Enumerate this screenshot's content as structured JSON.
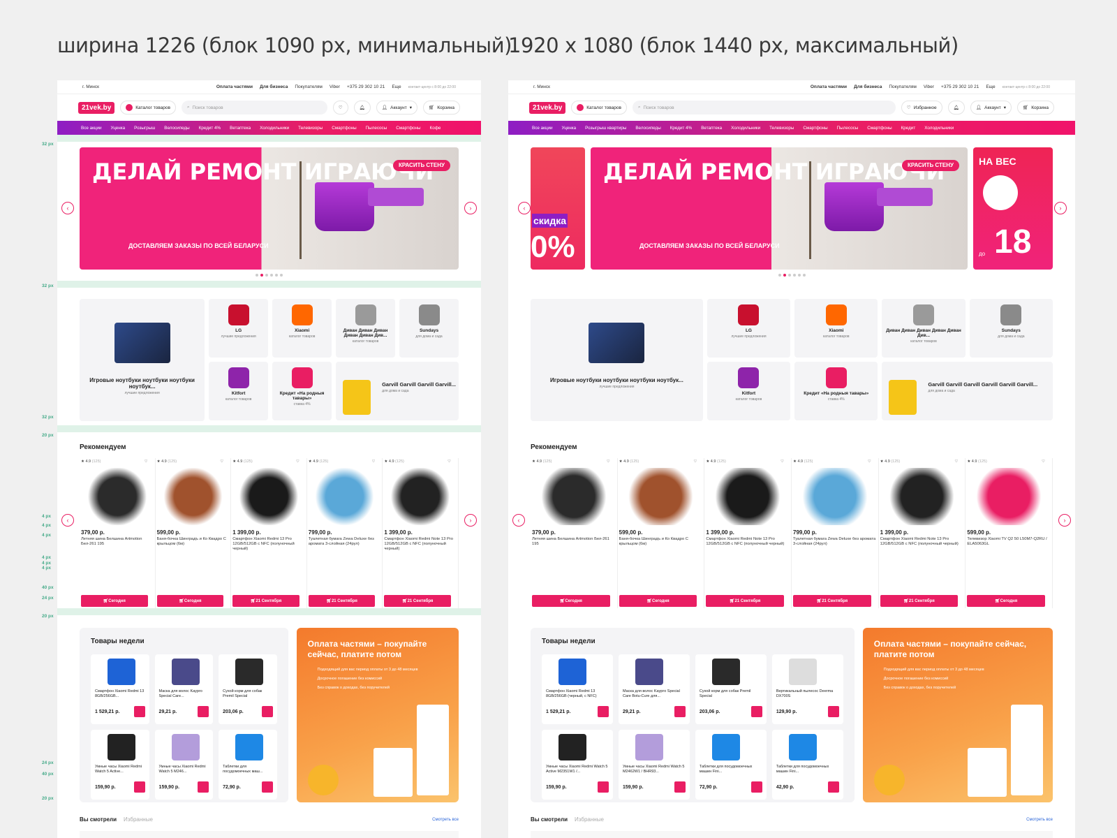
{
  "captions": {
    "left": "ширина 1226 (блок 1090 px, минимальный)",
    "right": "1920 x 1080 (блок 1440 px, максимальный)"
  },
  "topbar": {
    "city": "г. Минск",
    "installment": "Оплата частями",
    "business": "Для бизнеса",
    "buyers": "Покупателям",
    "viber": "Viber",
    "phone": "+375 29 302 10 21",
    "more": "Еще",
    "hours": "контакт-центр с 8:00 до 22:00"
  },
  "header": {
    "logo": "21vek.by",
    "catalog": "Каталог товаров",
    "search_placeholder": "Поиск товаров",
    "favorites": "Избранное",
    "account": "Аккаунт",
    "cart": "Корзина"
  },
  "nav_left": [
    "Все акции",
    "Уценка",
    "Розыгрыш",
    "Велосипеды",
    "Кредит 4%",
    "Ветаптека",
    "Холодильники",
    "Телевизоры",
    "Смартфоны",
    "Пылесосы",
    "Смартфоны",
    "Кофе"
  ],
  "nav_right": [
    "Все акции",
    "Уценка",
    "Розыгрыш квартиры",
    "Велосипеды",
    "Кредит 4%",
    "Ветаптека",
    "Холодильники",
    "Телевизоры",
    "Смартфоны",
    "Пылесосы",
    "Смартфоны",
    "Кредит",
    "Холодильники"
  ],
  "banner": {
    "title": "ДЕЛАЙ РЕМОНТ ИГРАЮЧИ",
    "subtitle": "ДОСТАВЛЯЕМ ЗАКАЗЫ ПО ВСЕЙ БЕЛАРУСИ",
    "tag": "КРАСИТЬ СТЕНУ",
    "side_left": "скидка",
    "side_left_pct": "0%",
    "side_right_top": "НА ВЕС",
    "side_right_big": "18",
    "side_right_pre": "до"
  },
  "categories": {
    "big": {
      "name": "Игровые ноутбуки ноутбуки ноутбуки ноутбук...",
      "sub": "лучшие предложения"
    },
    "items": [
      {
        "name": "LG",
        "sub": "лучшие предложения",
        "color": "#c8102e"
      },
      {
        "name": "Xiaomi",
        "sub": "каталог товаров",
        "color": "#ff6700"
      },
      {
        "name": "Диван Диван Диван Диван Диван Див...",
        "sub": "каталог товаров",
        "color": "#9a9a9a"
      },
      {
        "name": "Sundays",
        "sub": "для дома и сада",
        "color": "#8a8a8a"
      },
      {
        "name": "Kitfort",
        "sub": "каталог товаров",
        "color": "#8e24aa"
      },
      {
        "name": "Кредит «На родныя тавары»",
        "sub": "ставка 4%",
        "color": "#e91e63"
      }
    ],
    "wide": {
      "name": "Garvill Garvill Garvill Garvill...",
      "name_right": "Garvill Garvill Garvill Garvill Garvill Garvill...",
      "sub": "для дома и сада"
    }
  },
  "recommend": {
    "title": "Рекомендуем",
    "rating": "4.9",
    "reviews": "(125)",
    "products_left": [
      {
        "price": "379,00 р.",
        "name": "Летняя шина Белшина Artmotion Бел-261 195",
        "btn": "Сегодня",
        "color": "#2b2b2b"
      },
      {
        "price": "599,00 р.",
        "name": "Баня-бочка Шинградъ и Ко Квадро С крыльцом (6м)",
        "btn": "Сегодня",
        "color": "#a0522d"
      },
      {
        "price": "1 399,00 р.",
        "name": "Смартфон Xiaomi Redmi 13 Pro 12GB/512GB с NFC (полуночный черный)",
        "btn": "21 Сентября",
        "color": "#1a1a1a"
      },
      {
        "price": "799,00 р.",
        "name": "Туалетная бумага Zewa Deluxe без аромата 3-слойная (24рул)",
        "btn": "21 Сентября",
        "color": "#5aa8d8"
      },
      {
        "price": "1 399,00 р.",
        "name": "Смартфон Xiaomi Redmi Note 13 Pro 12GB/512GB с NFC (полуночный черный)",
        "btn": "21 Сентября",
        "color": "#222"
      }
    ],
    "products_right": [
      {
        "price": "379,00 р.",
        "name": "Летняя шина Белшина Artmotion Бел-261 195",
        "btn": "Сегодня",
        "color": "#2b2b2b"
      },
      {
        "price": "599,00 р.",
        "name": "Баня-бочка Шинградъ и Ко Квадро С крыльцом (6м)",
        "btn": "Сегодня",
        "color": "#a0522d"
      },
      {
        "price": "1 399,00 р.",
        "name": "Смартфон Xiaomi Redmi Note 13 Pro 12GB/512GB с NFC (полуночный черный)",
        "btn": "21 Сентября",
        "color": "#1a1a1a"
      },
      {
        "price": "799,00 р.",
        "name": "Туалетная бумага Zewa Deluxe без аромата 3-слойная (24рул)",
        "btn": "21 Сентября",
        "color": "#5aa8d8"
      },
      {
        "price": "1 399,00 р.",
        "name": "Смартфон Xiaomi Redmi Note 13 Pro 12GB/512GB с NFC (полуночный черный)",
        "btn": "21 Сентября",
        "color": "#222"
      },
      {
        "price": "599,00 р.",
        "name": "Телевизор Xiaomi TV Q2 50 L50M7-Q2RU / ELA5063GL",
        "btn": "Сегодня",
        "color": "#e91e63"
      }
    ]
  },
  "week": {
    "title": "Товары недели",
    "items_left": [
      {
        "name": "Смартфон Xiaomi Redmi 13 8GB/256GB...",
        "price": "1 529,21 р.",
        "color": "#1e63d6"
      },
      {
        "name": "Маска для волос Kaypro Special Care...",
        "price": "29,21 р.",
        "color": "#4a4a8a"
      },
      {
        "name": "Сухой корм для собак Premil Special",
        "price": "203,06 р.",
        "color": "#2a2a2a"
      },
      {
        "name": "Умные часы Xiaomi Redmi Watch 5 Active...",
        "price": "159,90 р.",
        "color": "#222"
      },
      {
        "name": "Умные часы Xiaomi Redmi Watch 5 M246...",
        "price": "159,90 р.",
        "color": "#b39ddb"
      },
      {
        "name": "Таблетки для посудомоечных маш...",
        "price": "72,90 р.",
        "color": "#1e88e5"
      }
    ],
    "items_right": [
      {
        "name": "Смартфон Xiaomi Redmi 13 8GB/256GB (черный, с NFC)",
        "price": "1 529,21 р.",
        "color": "#1e63d6"
      },
      {
        "name": "Маска для волос Kaypro Special Care Botu-Cure для...",
        "price": "29,21 р.",
        "color": "#4a4a8a"
      },
      {
        "name": "Сухой корм для собак Premil Special",
        "price": "203,06 р.",
        "color": "#2a2a2a"
      },
      {
        "name": "Вертикальный пылесос Deerma DX700S",
        "price": "129,90 р.",
        "color": "#ddd"
      },
      {
        "name": "Умные часы Xiaomi Redmi Watch 5 Active M2351W1 /...",
        "price": "159,90 р.",
        "color": "#222"
      },
      {
        "name": "Умные часы Xiaomi Redmi Watch 5 M2462W1 / BHR93...",
        "price": "159,90 р.",
        "color": "#b39ddb"
      },
      {
        "name": "Таблетки для посудомоечных машин Fini...",
        "price": "72,90 р.",
        "color": "#1e88e5"
      },
      {
        "name": "Таблетки для посудомоечных машин Fini...",
        "price": "42,90 р.",
        "color": "#1e88e5"
      }
    ],
    "promo_title": "Оплата частями – покупайте сейчас, платите потом",
    "promo_points": [
      "Подходящий для вас период оплаты от 3 до 48 месяцев",
      "Досрочное погашение без комиссий",
      "Без справок о доходах, без поручителей"
    ]
  },
  "viewed": {
    "tab_active": "Вы смотрели",
    "tab_inactive": "Избранные",
    "see_all": "Смотреть все"
  },
  "annotations": [
    "32 px",
    "32 px",
    "32 px",
    "20 px",
    "4 px",
    "4 px",
    "4 px",
    "4 px",
    "4 px",
    "4 px",
    "40 px",
    "24 px",
    "20 px",
    "24 px",
    "40 px",
    "20 px"
  ],
  "colors": {
    "accent": "#e91e63",
    "purple": "#8e1ec4",
    "orange": "#f47a2c",
    "annotation": "#dff2e8"
  }
}
